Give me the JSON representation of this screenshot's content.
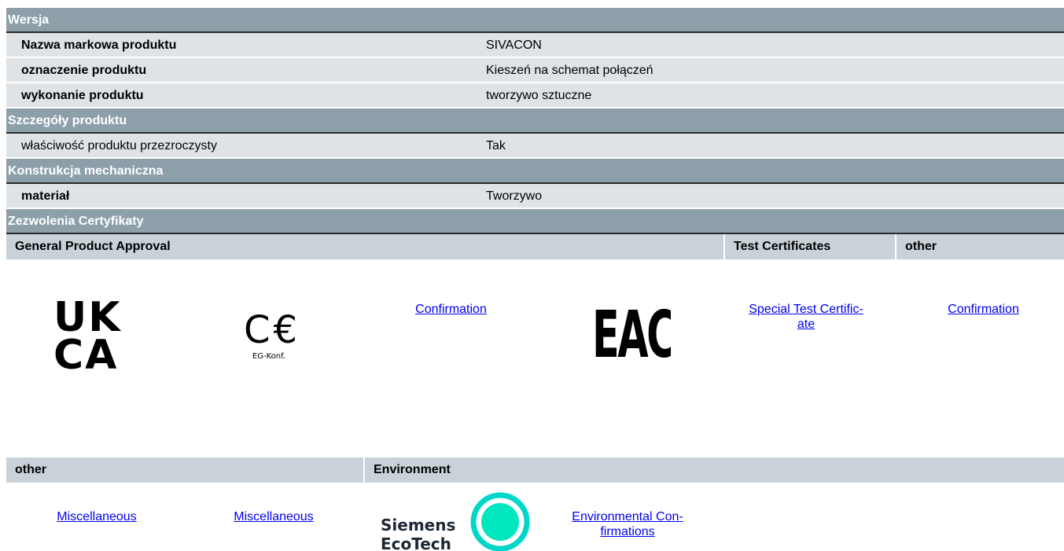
{
  "sections": {
    "wersja": "Wersja",
    "szczegoly": "Szczegóły produktu",
    "konstrukcja": "Konstrukcja mechaniczna",
    "zezwolenia": "Zezwolenia Certyfikaty"
  },
  "rows": {
    "nazwa": {
      "key": "Nazwa markowa produktu",
      "value": "SIVACON"
    },
    "oznaczenie": {
      "key": "oznaczenie produktu",
      "value": "Kieszeń na schemat połączeń"
    },
    "wykonanie": {
      "key": "wykonanie produktu",
      "value": "tworzywo sztuczne"
    },
    "wlasciwosc": {
      "key": "właściwość produktu przezroczysty",
      "value": "Tak"
    },
    "material": {
      "key": "materiał",
      "value": "Tworzywo"
    }
  },
  "cert_header": {
    "general": "General Product Approval",
    "test": "Test Certificates",
    "other": "other"
  },
  "cert_row": {
    "ukca_top": "UK",
    "ukca_bottom": "CA",
    "ce_mark": "C€",
    "ce_caption": "EG-Konf.",
    "confirmation_1": "Confirmation",
    "eac_mark": "EAC",
    "special_test_1": "Special Test Certific-",
    "special_test_2": "ate",
    "confirmation_2": "Confirmation"
  },
  "env_header": {
    "other": "other",
    "environment": "Environment"
  },
  "env_row": {
    "misc_1": "Miscellaneous",
    "misc_2": "Miscellaneous",
    "ecotech_1": "Siemens",
    "ecotech_2": "EcoTech",
    "env_conf_1": "Environmental Con-",
    "env_conf_2": "firmations"
  }
}
